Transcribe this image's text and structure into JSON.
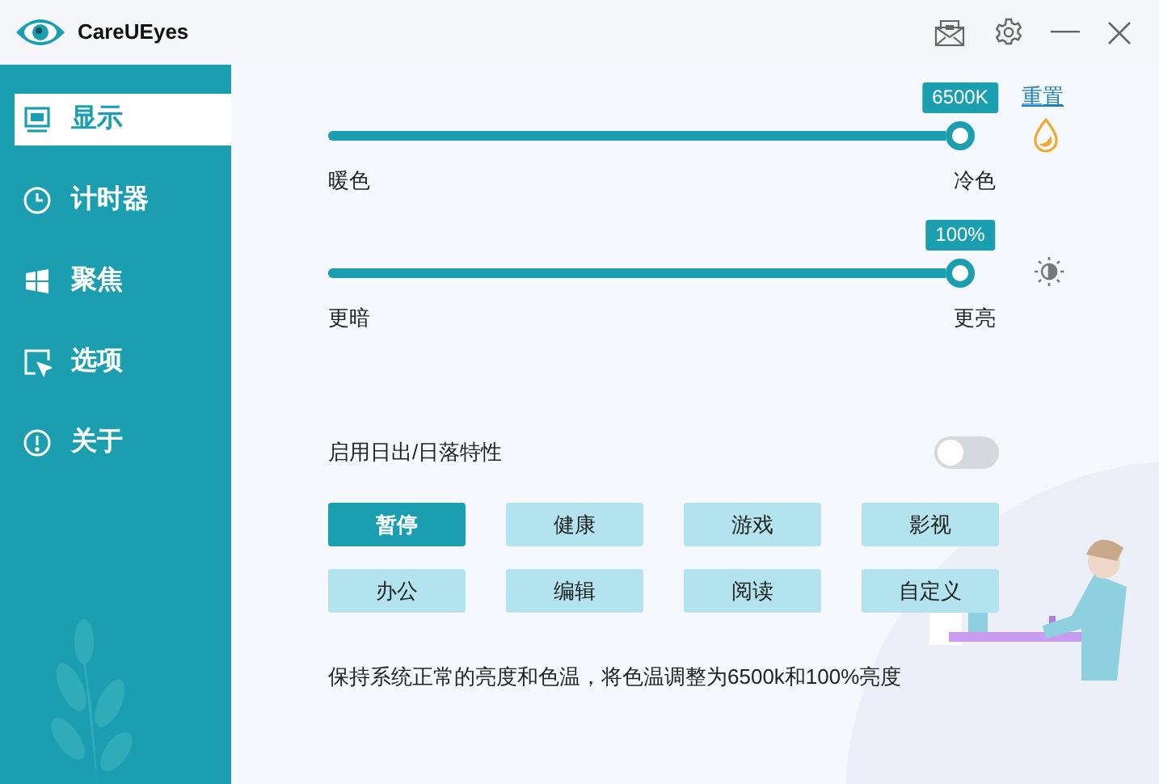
{
  "app": {
    "title": "CareUEyes"
  },
  "sidebar": {
    "items": [
      {
        "label": "显示",
        "kind": "monitor",
        "selected": true
      },
      {
        "label": "计时器",
        "kind": "clock",
        "selected": false
      },
      {
        "label": "聚焦",
        "kind": "windows",
        "selected": false
      },
      {
        "label": "选项",
        "kind": "cursor",
        "selected": false
      },
      {
        "label": "关于",
        "kind": "info",
        "selected": false
      }
    ]
  },
  "reset_link": "重置",
  "sliders": [
    {
      "kind": "temperature",
      "value_badge": "6500K",
      "level": 1,
      "left_label": "暖色",
      "right_label": "冷色"
    },
    {
      "kind": "brightness",
      "value_badge": "100%",
      "level": 1,
      "left_label": "更暗",
      "right_label": "更亮"
    }
  ],
  "sunrise_toggle": {
    "label": "启用日出/日落特性",
    "on": false
  },
  "presets": [
    {
      "label": "暂停",
      "selected": true
    },
    {
      "label": "健康",
      "selected": false
    },
    {
      "label": "游戏",
      "selected": false
    },
    {
      "label": "影视",
      "selected": false
    },
    {
      "label": "办公",
      "selected": false
    },
    {
      "label": "编辑",
      "selected": false
    },
    {
      "label": "阅读",
      "selected": false
    },
    {
      "label": "自定义",
      "selected": false
    }
  ],
  "description": "保持系统正常的亮度和色温，将色温调整为6500k和100%亮度"
}
